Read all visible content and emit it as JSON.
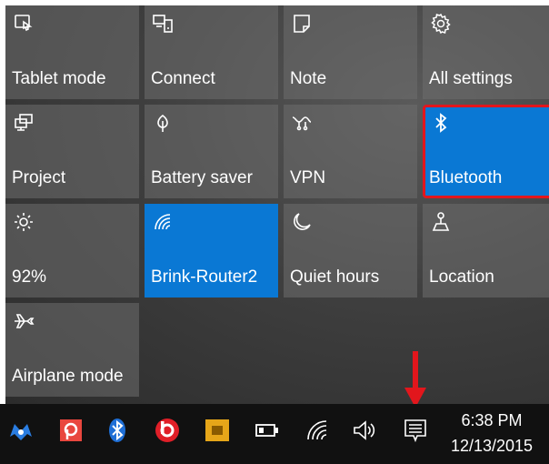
{
  "action_center": {
    "tiles": [
      {
        "label": "Tablet mode",
        "icon": "tablet-mode-icon"
      },
      {
        "label": "Connect",
        "icon": "connect-icon"
      },
      {
        "label": "Note",
        "icon": "note-icon"
      },
      {
        "label": "All settings",
        "icon": "gear-icon"
      },
      {
        "label": "Project",
        "icon": "project-icon"
      },
      {
        "label": "Battery saver",
        "icon": "battery-saver-icon"
      },
      {
        "label": "VPN",
        "icon": "vpn-icon"
      },
      {
        "label": "Bluetooth",
        "icon": "bluetooth-icon",
        "state": "on",
        "highlighted": true
      },
      {
        "label": "92%",
        "icon": "brightness-icon"
      },
      {
        "label": "Brink-Router2",
        "icon": "wifi-icon",
        "state": "on"
      },
      {
        "label": "Quiet hours",
        "icon": "moon-icon"
      },
      {
        "label": "Location",
        "icon": "location-icon"
      },
      {
        "label": "Airplane mode",
        "icon": "airplane-icon"
      }
    ]
  },
  "taskbar": {
    "icons": [
      "malwarebytes-icon",
      "pushbullet-icon",
      "bluetooth-tray-icon",
      "beats-icon",
      "media-icon",
      "battery-icon",
      "wifi-tray-icon",
      "volume-icon",
      "action-center-icon"
    ],
    "time": "6:38 PM",
    "date": "12/13/2015"
  },
  "colors": {
    "active_tile": "#0a78d4",
    "highlight_border": "#e2161c",
    "arrow": "#e2161c"
  }
}
